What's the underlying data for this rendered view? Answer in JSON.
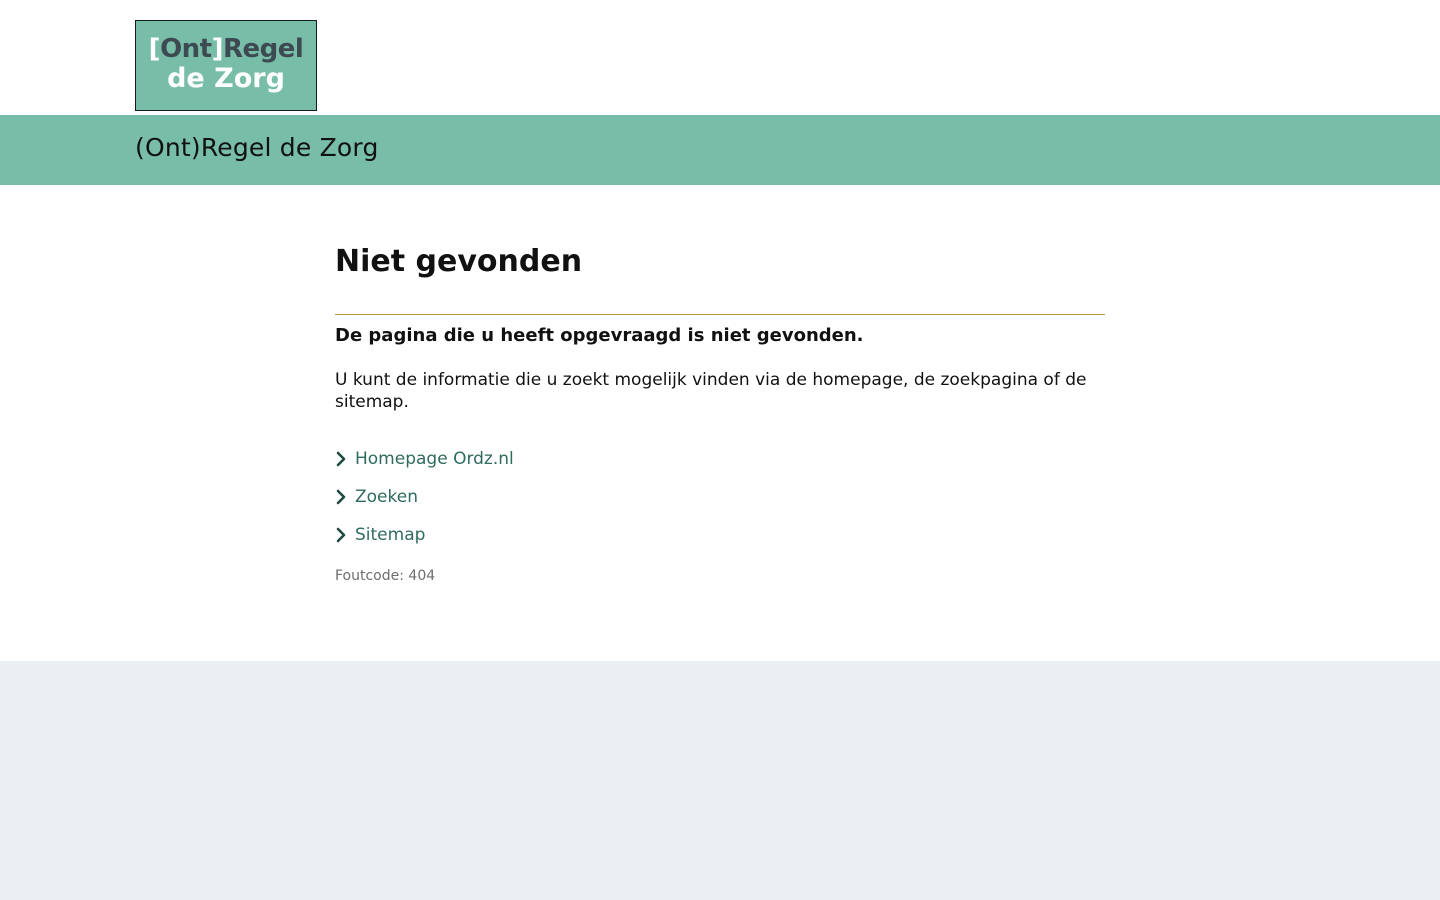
{
  "header": {
    "logo": {
      "line1_open_bracket": "[",
      "line1_word": "Ont",
      "line1_close_bracket": "]",
      "line1_rest": "Regel",
      "line2": "de Zorg"
    },
    "site_title": "(Ont)Regel de Zorg"
  },
  "main": {
    "heading": "Niet gevonden",
    "lead": "De pagina die u heeft opgevraagd is niet gevonden.",
    "paragraph": "U kunt de informatie die u zoekt mogelijk vinden via de homepage, de zoekpagina of de sitemap.",
    "links": [
      {
        "label": "Homepage Ordz.nl",
        "icon": "chevron-right-icon"
      },
      {
        "label": "Zoeken",
        "icon": "chevron-right-icon"
      },
      {
        "label": "Sitemap",
        "icon": "chevron-right-icon"
      }
    ],
    "error_code": "Foutcode: 404"
  },
  "colors": {
    "brand_green": "#77bda8",
    "link_color": "#2f6b5e",
    "divider": "#b89a3c",
    "footer_bg": "#ebeff2"
  }
}
